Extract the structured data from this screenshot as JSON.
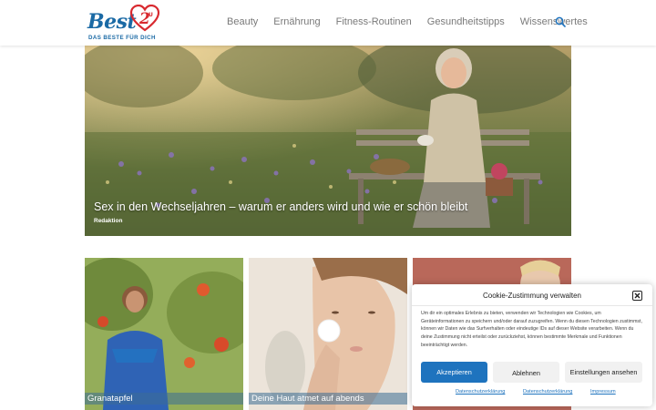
{
  "brand": {
    "logo_text": "Best",
    "badge_text": "2U",
    "tagline": "DAS BESTE FÜR DICH",
    "accent": "#1b6aa5",
    "badge_color": "#d8292f"
  },
  "nav": {
    "items": [
      "Beauty",
      "Ernährung",
      "Fitness-Routinen",
      "Gesundheitstipps",
      "Wissenswertes"
    ],
    "search_icon": "search-icon"
  },
  "hero": {
    "title": "Sex in den Wechseljahren – warum er anders wird und wie er schön bleibt",
    "author": "Redaktion"
  },
  "cards": [
    {
      "caption": "Granatapfel"
    },
    {
      "caption": "Deine Haut atmet auf abends"
    },
    {
      "caption": ""
    }
  ],
  "cookie": {
    "title": "Cookie-Zustimmung verwalten",
    "text": "Um dir ein optimales Erlebnis zu bieten, verwenden wir Technologien wie Cookies, um Geräteinformationen zu speichern und/oder darauf zuzugreifen. Wenn du diesen Technologien zustimmst, können wir Daten wie das Surfverhalten oder eindeutige IDs auf dieser Website verarbeiten. Wenn du deine Zustimmung nicht erteilst oder zurückziehst, können bestimmte Merkmale und Funktionen beeinträchtigt werden.",
    "accept": "Akzeptieren",
    "deny": "Ablehnen",
    "settings": "Einstellungen ansehen",
    "links": [
      "Datenschutzerklärung",
      "Datenschutzerklärung",
      "Impressum"
    ],
    "primary_color": "#1e73be"
  }
}
